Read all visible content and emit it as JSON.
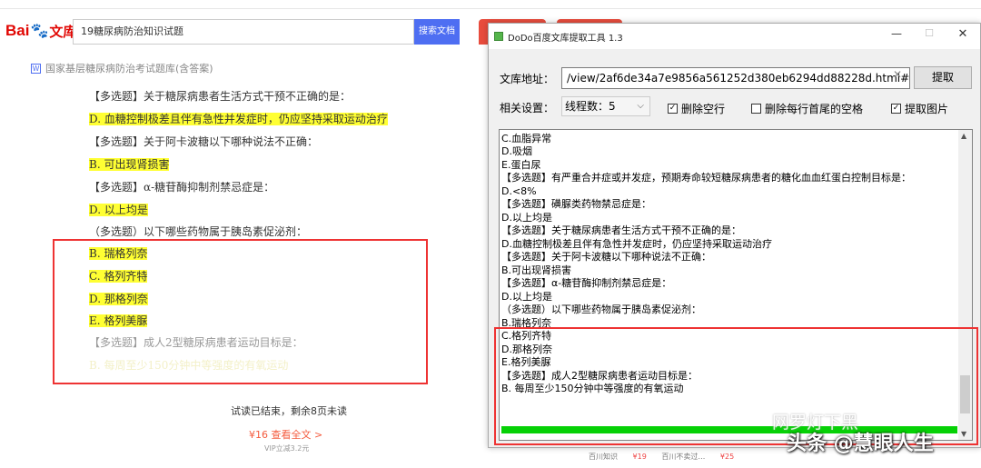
{
  "baidu": {
    "logo_text_a": "Bai",
    "logo_paw": "🐾",
    "logo_text_b": "文库",
    "search_value": "19糖尿病防治知识试题",
    "search_button": "搜索文档",
    "doc_title": "国家基层糖尿病防治考试题库(含答案)",
    "doc_lines": [
      "【多选题】关于糖尿病患者生活方式干预不正确的是：",
      "D. 血糖控制极差且伴有急性并发症时，仍应坚持采取运动治疗",
      "【多选题】关于阿卡波糖以下哪种说法不正确：",
      "B. 可出现肾损害",
      "【多选题】α-糖苷酶抑制剂禁忌症是：",
      "D. 以上均是",
      "（多选题）以下哪些药物属于胰岛素促泌剂：",
      "B. 瑞格列奈",
      "C. 格列齐特",
      "D. 那格列奈",
      "E. 格列美脲",
      "【多选题】成人2型糖尿病患者运动目标是：",
      "B. 每周至少150分钟中等强度的有氧运动"
    ],
    "trial_end": "试读已结束，剩余8页未读",
    "buy_full": "¥16 查看全文 >",
    "vip_note": "VIP立减3.2元",
    "promo": [
      "百川知识",
      "¥19",
      "百川不卖过…",
      "¥25"
    ]
  },
  "window": {
    "title": "DoDo百度文库提取工具 1.3",
    "min_glyph": "—",
    "max_glyph": "☐",
    "close_glyph": "✕",
    "url_label": "文库地址：",
    "url_value": "/view/2af6de34a7e9856a561252d380eb6294dd88228d.html#",
    "clear_glyph": "✕",
    "extract_button": "提取",
    "settings_label": "相关设置：",
    "thread_value": "线程数：5",
    "chevron": "⌵",
    "checkboxes": [
      {
        "label": "删除空行",
        "checked": true
      },
      {
        "label": "删除每行首尾的空格",
        "checked": false
      },
      {
        "label": "提取图片",
        "checked": true
      }
    ],
    "check_glyph": "✓",
    "lines": [
      "C.血脂异常",
      "D.吸烟",
      "E.蛋白尿",
      "【多选题】有严重合并症或并发症，预期寿命较短糖尿病患者的糖化血血红蛋白控制目标是：",
      "D.<8%",
      "【多选题】磺脲类药物禁忌症是：",
      "D.以上均是",
      "【多选题】关于糖尿病患者生活方式干预不正确的是：",
      "D.血糖控制极差且伴有急性并发症时，仍应坚持采取运动治疗",
      "【多选题】关于阿卡波糖以下哪种说法不正确：",
      "B.可出现肾损害",
      "【多选题】α-糖苷酶抑制剂禁忌症是：",
      "D.以上均是",
      "（多选题）以下哪些药物属于胰岛素促泌剂：",
      "B.瑞格列奈",
      "C.格列齐特",
      "D.那格列奈",
      "E.格列美脲",
      "【多选题】成人2型糖尿病患者运动目标是：",
      "B. 每周至少150分钟中等强度的有氧运动"
    ],
    "scroll_up": "▲",
    "scroll_down": "▼",
    "progress": 1.0,
    "progress_color": "#06d106"
  },
  "watermark": {
    "line1": "网罗灯下黑",
    "line2": "头条 @慧眼人生"
  }
}
